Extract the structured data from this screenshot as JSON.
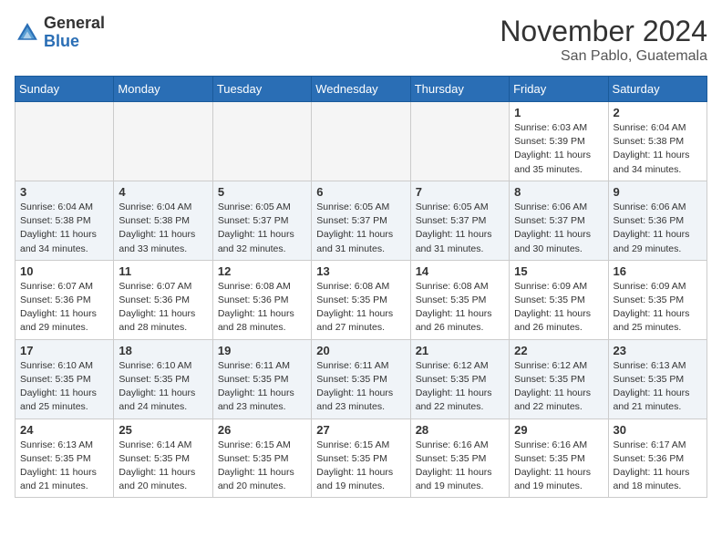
{
  "header": {
    "logo_general": "General",
    "logo_blue": "Blue",
    "month": "November 2024",
    "location": "San Pablo, Guatemala"
  },
  "days_of_week": [
    "Sunday",
    "Monday",
    "Tuesday",
    "Wednesday",
    "Thursday",
    "Friday",
    "Saturday"
  ],
  "weeks": [
    [
      {
        "day": "",
        "info": ""
      },
      {
        "day": "",
        "info": ""
      },
      {
        "day": "",
        "info": ""
      },
      {
        "day": "",
        "info": ""
      },
      {
        "day": "",
        "info": ""
      },
      {
        "day": "1",
        "info": "Sunrise: 6:03 AM\nSunset: 5:39 PM\nDaylight: 11 hours\nand 35 minutes."
      },
      {
        "day": "2",
        "info": "Sunrise: 6:04 AM\nSunset: 5:38 PM\nDaylight: 11 hours\nand 34 minutes."
      }
    ],
    [
      {
        "day": "3",
        "info": "Sunrise: 6:04 AM\nSunset: 5:38 PM\nDaylight: 11 hours\nand 34 minutes."
      },
      {
        "day": "4",
        "info": "Sunrise: 6:04 AM\nSunset: 5:38 PM\nDaylight: 11 hours\nand 33 minutes."
      },
      {
        "day": "5",
        "info": "Sunrise: 6:05 AM\nSunset: 5:37 PM\nDaylight: 11 hours\nand 32 minutes."
      },
      {
        "day": "6",
        "info": "Sunrise: 6:05 AM\nSunset: 5:37 PM\nDaylight: 11 hours\nand 31 minutes."
      },
      {
        "day": "7",
        "info": "Sunrise: 6:05 AM\nSunset: 5:37 PM\nDaylight: 11 hours\nand 31 minutes."
      },
      {
        "day": "8",
        "info": "Sunrise: 6:06 AM\nSunset: 5:37 PM\nDaylight: 11 hours\nand 30 minutes."
      },
      {
        "day": "9",
        "info": "Sunrise: 6:06 AM\nSunset: 5:36 PM\nDaylight: 11 hours\nand 29 minutes."
      }
    ],
    [
      {
        "day": "10",
        "info": "Sunrise: 6:07 AM\nSunset: 5:36 PM\nDaylight: 11 hours\nand 29 minutes."
      },
      {
        "day": "11",
        "info": "Sunrise: 6:07 AM\nSunset: 5:36 PM\nDaylight: 11 hours\nand 28 minutes."
      },
      {
        "day": "12",
        "info": "Sunrise: 6:08 AM\nSunset: 5:36 PM\nDaylight: 11 hours\nand 28 minutes."
      },
      {
        "day": "13",
        "info": "Sunrise: 6:08 AM\nSunset: 5:35 PM\nDaylight: 11 hours\nand 27 minutes."
      },
      {
        "day": "14",
        "info": "Sunrise: 6:08 AM\nSunset: 5:35 PM\nDaylight: 11 hours\nand 26 minutes."
      },
      {
        "day": "15",
        "info": "Sunrise: 6:09 AM\nSunset: 5:35 PM\nDaylight: 11 hours\nand 26 minutes."
      },
      {
        "day": "16",
        "info": "Sunrise: 6:09 AM\nSunset: 5:35 PM\nDaylight: 11 hours\nand 25 minutes."
      }
    ],
    [
      {
        "day": "17",
        "info": "Sunrise: 6:10 AM\nSunset: 5:35 PM\nDaylight: 11 hours\nand 25 minutes."
      },
      {
        "day": "18",
        "info": "Sunrise: 6:10 AM\nSunset: 5:35 PM\nDaylight: 11 hours\nand 24 minutes."
      },
      {
        "day": "19",
        "info": "Sunrise: 6:11 AM\nSunset: 5:35 PM\nDaylight: 11 hours\nand 23 minutes."
      },
      {
        "day": "20",
        "info": "Sunrise: 6:11 AM\nSunset: 5:35 PM\nDaylight: 11 hours\nand 23 minutes."
      },
      {
        "day": "21",
        "info": "Sunrise: 6:12 AM\nSunset: 5:35 PM\nDaylight: 11 hours\nand 22 minutes."
      },
      {
        "day": "22",
        "info": "Sunrise: 6:12 AM\nSunset: 5:35 PM\nDaylight: 11 hours\nand 22 minutes."
      },
      {
        "day": "23",
        "info": "Sunrise: 6:13 AM\nSunset: 5:35 PM\nDaylight: 11 hours\nand 21 minutes."
      }
    ],
    [
      {
        "day": "24",
        "info": "Sunrise: 6:13 AM\nSunset: 5:35 PM\nDaylight: 11 hours\nand 21 minutes."
      },
      {
        "day": "25",
        "info": "Sunrise: 6:14 AM\nSunset: 5:35 PM\nDaylight: 11 hours\nand 20 minutes."
      },
      {
        "day": "26",
        "info": "Sunrise: 6:15 AM\nSunset: 5:35 PM\nDaylight: 11 hours\nand 20 minutes."
      },
      {
        "day": "27",
        "info": "Sunrise: 6:15 AM\nSunset: 5:35 PM\nDaylight: 11 hours\nand 19 minutes."
      },
      {
        "day": "28",
        "info": "Sunrise: 6:16 AM\nSunset: 5:35 PM\nDaylight: 11 hours\nand 19 minutes."
      },
      {
        "day": "29",
        "info": "Sunrise: 6:16 AM\nSunset: 5:35 PM\nDaylight: 11 hours\nand 19 minutes."
      },
      {
        "day": "30",
        "info": "Sunrise: 6:17 AM\nSunset: 5:36 PM\nDaylight: 11 hours\nand 18 minutes."
      }
    ]
  ]
}
